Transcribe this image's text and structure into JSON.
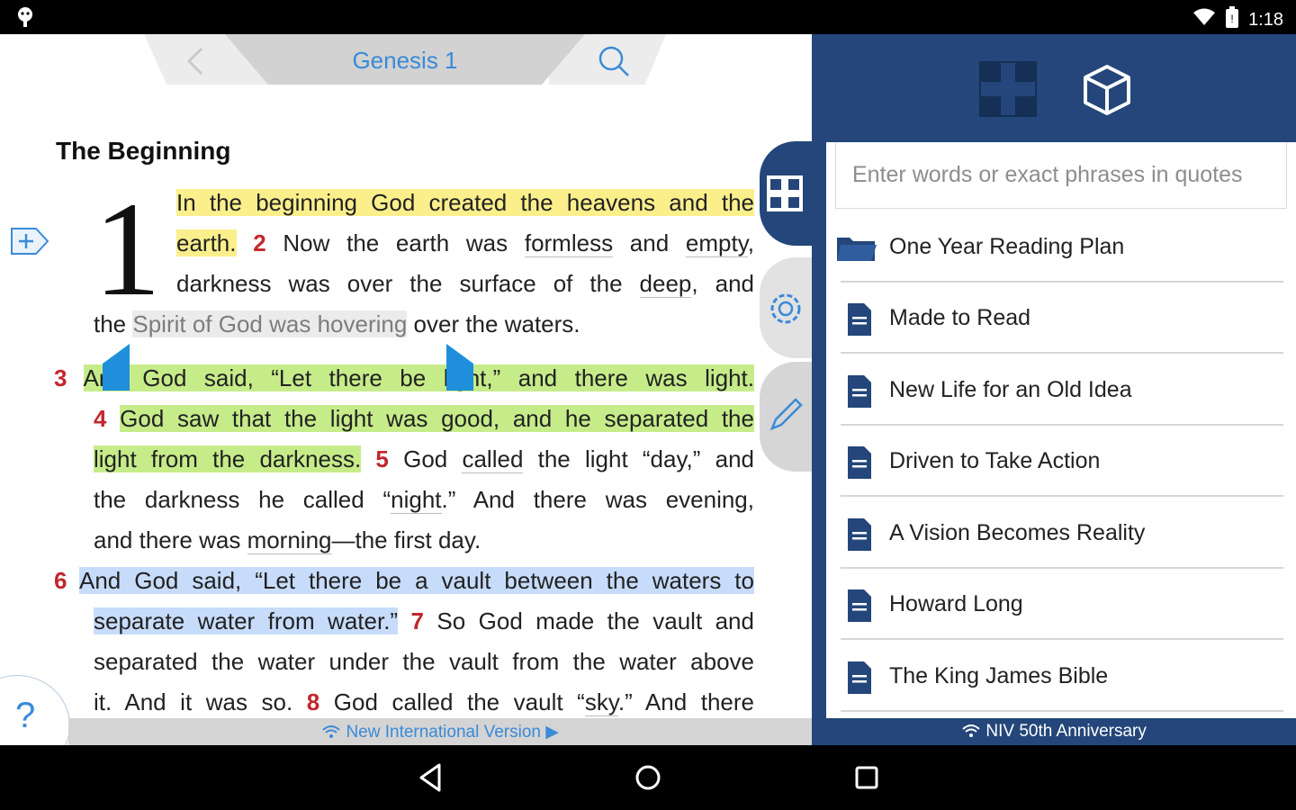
{
  "status_bar": {
    "time": "1:18",
    "icons": [
      "android-debug-icon",
      "wifi-icon",
      "battery-icon"
    ]
  },
  "reader": {
    "chapter": "Genesis 1",
    "heading": "The Beginning",
    "dropcap": "1",
    "lines": [
      [
        {
          "t": "In the beginning God created the heavens and the",
          "c": "hl-y"
        }
      ],
      [
        {
          "t": "earth.",
          "c": "hl-y"
        },
        {
          "t": " "
        },
        {
          "t": "2",
          "c": "vnum"
        },
        {
          "t": " Now the earth was "
        },
        {
          "t": "formless",
          "c": "u"
        },
        {
          "t": " and "
        },
        {
          "t": "empty",
          "c": "u"
        },
        {
          "t": ","
        }
      ],
      [
        {
          "t": "darkness was over the surface of the "
        },
        {
          "t": "deep",
          "c": "u"
        },
        {
          "t": ", and"
        }
      ],
      [
        {
          "t": "the "
        },
        {
          "t": "Spirit of God was hovering",
          "c": "hl-gray"
        },
        {
          "t": " over the waters."
        }
      ],
      [
        {
          "t": "3",
          "c": "vnum"
        },
        {
          "t": " "
        },
        {
          "t": "And God said, “Let there be light,” and there was light.",
          "c": "hl-g"
        }
      ],
      [
        {
          "t": "4",
          "c": "vnum"
        },
        {
          "t": " "
        },
        {
          "t": "God saw that the light was good, and he separated the",
          "c": "hl-g"
        }
      ],
      [
        {
          "t": "light from the darkness.",
          "c": "hl-g"
        },
        {
          "t": " "
        },
        {
          "t": "5",
          "c": "vnum"
        },
        {
          "t": " God "
        },
        {
          "t": "called",
          "c": "u"
        },
        {
          "t": " the light “day,” and"
        }
      ],
      [
        {
          "t": "the darkness he called “"
        },
        {
          "t": "night",
          "c": "u"
        },
        {
          "t": ".” And there was evening,"
        }
      ],
      [
        {
          "t": "and there was "
        },
        {
          "t": "morning",
          "c": "u"
        },
        {
          "t": "—the first day."
        }
      ],
      [
        {
          "t": "6",
          "c": "vnum"
        },
        {
          "t": " "
        },
        {
          "t": "And God said, “Let there be a vault between the waters to",
          "c": "hl-b"
        }
      ],
      [
        {
          "t": "separate water from water.”",
          "c": "hl-b"
        },
        {
          "t": " "
        },
        {
          "t": "7",
          "c": "vnum"
        },
        {
          "t": " So God made the vault and"
        }
      ],
      [
        {
          "t": "separated the water under the vault from the water above"
        }
      ],
      [
        {
          "t": "it. And it was so. "
        },
        {
          "t": "8",
          "c": "vnum"
        },
        {
          "t": " God called the vault “"
        },
        {
          "t": "sky",
          "c": "u"
        },
        {
          "t": ".” And there"
        }
      ]
    ],
    "help_label": "?",
    "version": "New International Version ▶"
  },
  "side_tabs": [
    "study-tab",
    "settings-tab",
    "notes-tab"
  ],
  "panel": {
    "search_placeholder": "Enter words or exact phrases in quotes",
    "resources": [
      {
        "label": "One Year Reading Plan",
        "icon": "folder-icon"
      },
      {
        "label": "Made to Read",
        "icon": "document-icon"
      },
      {
        "label": "New Life for an Old Idea",
        "icon": "document-icon"
      },
      {
        "label": "Driven to Take Action",
        "icon": "document-icon"
      },
      {
        "label": "A Vision Becomes Reality",
        "icon": "document-icon"
      },
      {
        "label": "Howard Long",
        "icon": "document-icon"
      },
      {
        "label": "The King James Bible",
        "icon": "document-icon"
      }
    ],
    "footer": "NIV 50th Anniversary"
  },
  "colors": {
    "panel_bg": "#24467a",
    "link_blue": "#3a8ad8",
    "verse_red": "#c1272d",
    "highlight_yellow": "#fbef8c",
    "highlight_green": "#c6ec8a",
    "highlight_blue": "#c7dcfb"
  }
}
